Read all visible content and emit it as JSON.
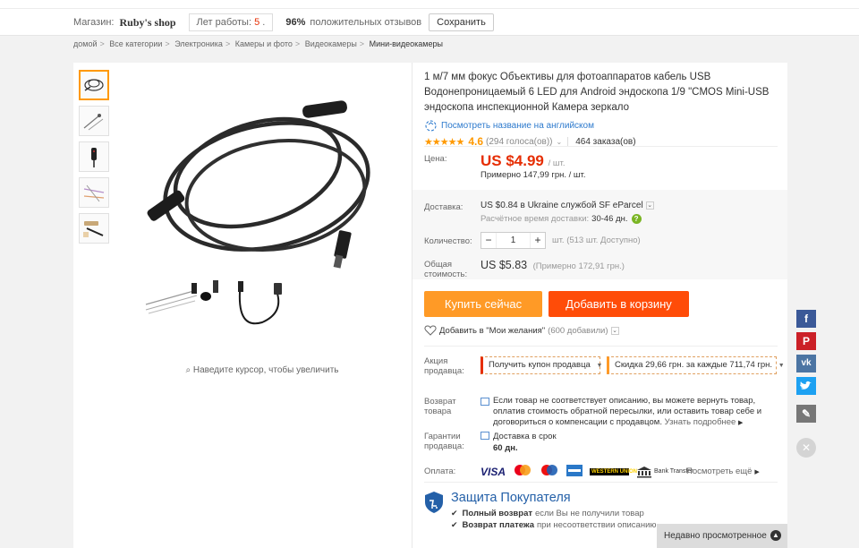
{
  "store": {
    "label": "Магазин:",
    "name": "Ruby's shop",
    "years_label": "Лет работы:",
    "years_value": "5",
    "years_suffix": ".",
    "positive_pct": "96%",
    "positive_text": "положительных отзывов",
    "save_label": "Сохранить"
  },
  "breadcrumb": [
    "домой",
    "Все категории",
    "Электроника",
    "Камеры и фото",
    "Видеокамеры",
    "Мини-видеокамеры"
  ],
  "gallery": {
    "zoom_hint": "Наведите курсор, чтобы увеличить",
    "thumbnails": [
      "thumb-1",
      "thumb-2",
      "thumb-3",
      "thumb-4",
      "thumb-5"
    ]
  },
  "product": {
    "title": "1 м/7 мм фокус Объективы для фотоаппаратов кабель USB Водонепроницаемый 6 LED для Android эндоскопа 1/9 \"CMOS Mini-USB эндоскопа инспекционной Камера зеркало",
    "translate_link": "Посмотреть название на английском",
    "stars": "★★★★★",
    "rating": "4.6",
    "votes": "(294 голоса(ов))",
    "orders": "464 заказа(ов)"
  },
  "price": {
    "label": "Цена:",
    "value": "US $4.99",
    "unit": "/ шт.",
    "approx": "Примерно 147,99 грн. / шт."
  },
  "shipping": {
    "label": "Доставка:",
    "value": "US $0.84 в Ukraine службой SF eParcel",
    "time_label": "Расчётное время доставки:",
    "time_value": "30-46 дн."
  },
  "quantity": {
    "label": "Количество:",
    "minus": "−",
    "value": "1",
    "plus": "+",
    "available": "шт. (513 шт. Доступно)"
  },
  "total": {
    "label_line1": "Общая",
    "label_line2": "стоимость:",
    "value": "US $5.83",
    "approx": "(Примерно 172,91 грн.)"
  },
  "actions": {
    "buy_now": "Купить сейчас",
    "add_to_cart": "Добавить в корзину",
    "wishlist": "Добавить в \"Мои желания\"",
    "wishlist_count": "(600 добавили)"
  },
  "promo": {
    "label_line1": "Акция",
    "label_line2": "продавца:",
    "coupon": "Получить купон продавца",
    "discount_prefix": "Скидка",
    "discount_value": "29,66 грн.",
    "discount_middle": "за каждые",
    "discount_threshold": "711,74 грн."
  },
  "returns": {
    "label_line1": "Возврат",
    "label_line2": "товара",
    "text": "Если товар не соответствует описанию, вы можете вернуть товар, оплатив стоимость обратной пересылки, или оставить товар себе и договориться о компенсации с продавцом.",
    "more": "Узнать подробнее"
  },
  "guarantee": {
    "label_line1": "Гарантии",
    "label_line2": "продавца:",
    "line1": "Доставка в срок",
    "line2": "60 дн."
  },
  "payment": {
    "label": "Оплата:",
    "methods": [
      "VISA",
      "MasterCard",
      "Maestro",
      "Amex",
      "WESTERN UNION",
      "Bank Transfer"
    ],
    "more": "Посмотреть ещё"
  },
  "protection": {
    "title": "Защита Покупателя",
    "item1_bold": "Полный возврат",
    "item1_rest": "если Вы не получили товар",
    "item2_bold": "Возврат платежа",
    "item2_rest": "при несоответствии описанию"
  },
  "recent": {
    "label": "Недавно просмотренное"
  },
  "colors": {
    "accent_orange": "#ff9a26",
    "cart_red": "#ff4c08",
    "price_red": "#e62e04",
    "link_blue": "#2d7acd"
  }
}
